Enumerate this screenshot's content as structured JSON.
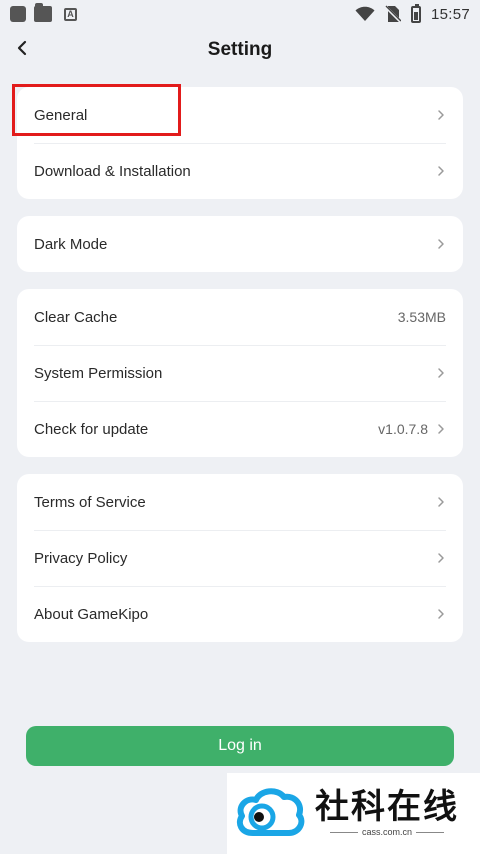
{
  "status_bar": {
    "time": "15:57",
    "icons": [
      "app-icon-1",
      "folder-icon",
      "font-a-icon",
      "wifi-icon",
      "no-sim-icon",
      "battery-charging-icon"
    ]
  },
  "header": {
    "title": "Setting",
    "back_icon": "chevron-left-icon"
  },
  "groups": [
    {
      "items": [
        {
          "label": "General",
          "value": ""
        },
        {
          "label": "Download & Installation",
          "value": ""
        }
      ]
    },
    {
      "items": [
        {
          "label": "Dark Mode",
          "value": ""
        }
      ]
    },
    {
      "items": [
        {
          "label": "Clear Cache",
          "value": "3.53MB"
        },
        {
          "label": "System Permission",
          "value": ""
        },
        {
          "label": "Check for update",
          "value": "v1.0.7.8"
        }
      ]
    },
    {
      "items": [
        {
          "label": "Terms of Service",
          "value": ""
        },
        {
          "label": "Privacy Policy",
          "value": ""
        },
        {
          "label": "About GameKipo",
          "value": ""
        }
      ]
    }
  ],
  "login": {
    "label": "Log in"
  },
  "watermark": {
    "main": "社科在线",
    "sub": "cass.com.cn"
  },
  "colors": {
    "background": "#eef0f4",
    "accent_green": "#3fb06a",
    "highlight_red": "#e21b1b",
    "watermark_blue": "#1aa6e6"
  }
}
